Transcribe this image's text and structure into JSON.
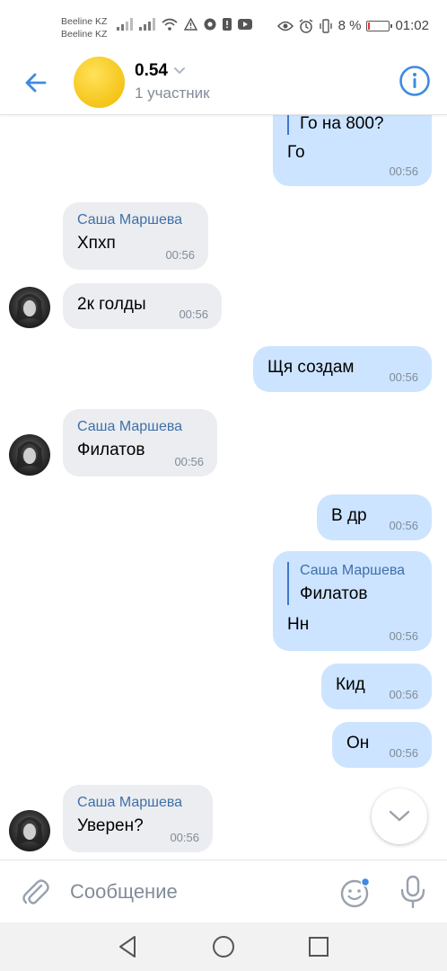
{
  "status_bar": {
    "carrier1": "Beeline KZ",
    "carrier2": "Beeline KZ",
    "battery": "8 %",
    "battery_level": 0.08,
    "time": "01:02"
  },
  "header": {
    "title": "0.54",
    "subtitle": "1 участник"
  },
  "messages": [
    {
      "dir": "out",
      "reply_text": "Го на 800?",
      "text": "Го",
      "time": "00:56"
    },
    {
      "dir": "in",
      "sender": "Саша Маршева",
      "text": "Хпхп",
      "time": "00:56"
    },
    {
      "dir": "in",
      "text": "2к голды",
      "time": "00:56"
    },
    {
      "dir": "out",
      "text": "Щя создам",
      "time": "00:56"
    },
    {
      "dir": "in",
      "sender": "Саша Маршева",
      "text": "Филатов",
      "time": "00:56"
    },
    {
      "dir": "out",
      "text": "В др",
      "time": "00:56"
    },
    {
      "dir": "out",
      "reply_sender": "Саша Маршева",
      "reply_text": "Филатов",
      "text": "Нн",
      "time": "00:56"
    },
    {
      "dir": "out",
      "text": "Кид",
      "time": "00:56"
    },
    {
      "dir": "out",
      "text": "Он",
      "time": "00:56"
    },
    {
      "dir": "in",
      "sender": "Саша Маршева",
      "text": "Уверен?",
      "time": "00:56"
    }
  ],
  "composer": {
    "placeholder": "Сообщение"
  },
  "colors": {
    "accent": "#3f8ae0",
    "incoming_bubble": "#ebedf0",
    "outgoing_bubble": "#cce4ff",
    "sender_name": "#3f6fa8",
    "chat_avatar": "#f5c518"
  }
}
